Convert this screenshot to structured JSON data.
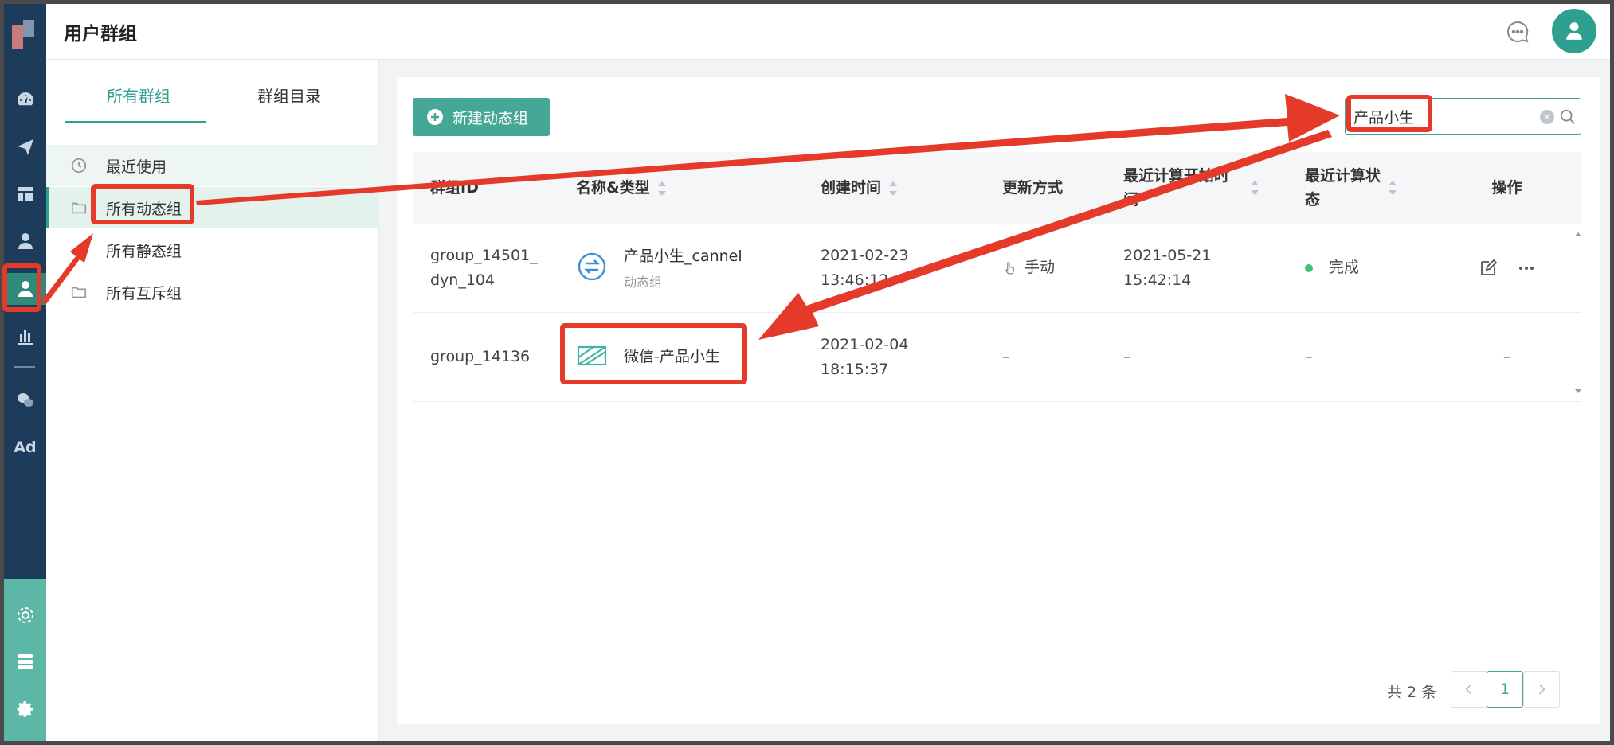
{
  "header": {
    "title": "用户群组"
  },
  "rail": {
    "ad_label": "Ad"
  },
  "subnav": {
    "tabs": [
      {
        "label": "所有群组"
      },
      {
        "label": "群组目录"
      }
    ],
    "items": [
      {
        "label": "最近使用"
      },
      {
        "label": "所有动态组"
      },
      {
        "label": "所有静态组"
      },
      {
        "label": "所有互斥组"
      }
    ]
  },
  "toolbar": {
    "new_button": "新建动态组"
  },
  "search": {
    "value": "产品小生"
  },
  "table": {
    "columns": [
      {
        "label": "群组ID"
      },
      {
        "label": "名称&类型"
      },
      {
        "label": "创建时间"
      },
      {
        "label": "更新方式"
      },
      {
        "label": "最近计算开始时间"
      },
      {
        "label": "最近计算状态"
      },
      {
        "label": "操作"
      }
    ],
    "rows": [
      {
        "id_line1": "group_14501_",
        "id_line2": "dyn_104",
        "name": "产品小生_cannel",
        "type": "动态组",
        "created_date": "2021-02-23",
        "created_time": "13:46:12",
        "update_mode": "手动",
        "calc_date": "2021-05-21",
        "calc_time": "15:42:14",
        "status": "完成"
      },
      {
        "id_line1": "group_14136",
        "name": "微信-产品小生",
        "created_date": "2021-02-04",
        "created_time": "18:15:37",
        "update_mode": "–",
        "calc_date": "–",
        "status": "–",
        "ops": "–"
      }
    ]
  },
  "pagination": {
    "total": "共 2 条",
    "current": "1"
  },
  "colors": {
    "accent": "#45a796",
    "rail": "#1d3c5c",
    "annotation": "#e53a2a",
    "status_ok": "#3ec271"
  }
}
